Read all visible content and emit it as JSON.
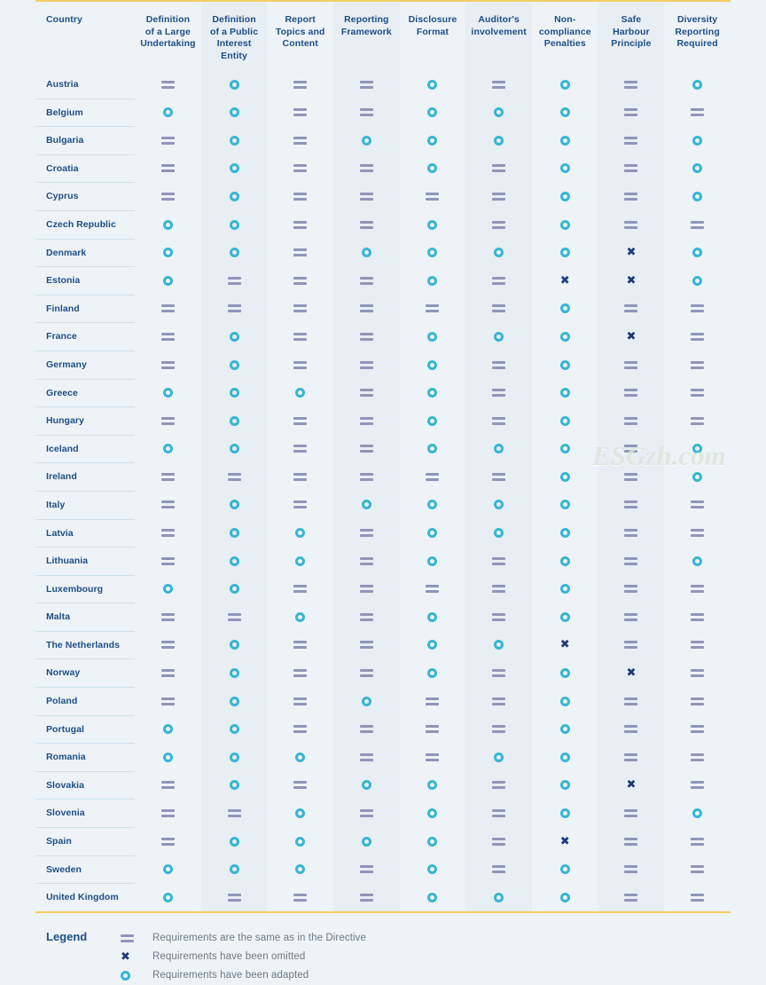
{
  "table": {
    "columns": [
      "Country",
      "Definition of a Large Undertaking",
      "Definition of a Public Interest Entity",
      "Report Topics and Content",
      "Reporting Framework",
      "Disclosure Format",
      "Auditor's involvement",
      "Non-compliance Penalties",
      "Safe Harbour Principle",
      "Diversity Reporting Required"
    ],
    "column_lines": [
      [
        "Country"
      ],
      [
        "Definition",
        "of a Large",
        "Undertaking"
      ],
      [
        "Definition",
        "of a Public",
        "Interest",
        "Entity"
      ],
      [
        "Report",
        "Topics and",
        "Content"
      ],
      [
        "Reporting",
        "Framework"
      ],
      [
        "Disclosure",
        "Format"
      ],
      [
        "Auditor's",
        "involvement"
      ],
      [
        "Non-",
        "compliance",
        "Penalties"
      ],
      [
        "Safe",
        "Harbour",
        "Principle"
      ],
      [
        "Diversity",
        "Reporting",
        "Required"
      ]
    ],
    "rows": [
      {
        "country": "Austria",
        "values": [
          "same",
          "adapted",
          "same",
          "same",
          "adapted",
          "same",
          "adapted",
          "same",
          "adapted"
        ]
      },
      {
        "country": "Belgium",
        "values": [
          "adapted",
          "adapted",
          "same",
          "same",
          "adapted",
          "adapted",
          "adapted",
          "same",
          "same"
        ]
      },
      {
        "country": "Bulgaria",
        "values": [
          "same",
          "adapted",
          "same",
          "adapted",
          "adapted",
          "adapted",
          "adapted",
          "same",
          "adapted"
        ]
      },
      {
        "country": "Croatia",
        "values": [
          "same",
          "adapted",
          "same",
          "same",
          "adapted",
          "same",
          "adapted",
          "same",
          "adapted"
        ]
      },
      {
        "country": "Cyprus",
        "values": [
          "same",
          "adapted",
          "same",
          "same",
          "same",
          "same",
          "adapted",
          "same",
          "adapted"
        ]
      },
      {
        "country": "Czech Republic",
        "values": [
          "adapted",
          "adapted",
          "same",
          "same",
          "adapted",
          "same",
          "adapted",
          "same",
          "same"
        ]
      },
      {
        "country": "Denmark",
        "values": [
          "adapted",
          "adapted",
          "same",
          "adapted",
          "adapted",
          "adapted",
          "adapted",
          "omitted",
          "adapted"
        ]
      },
      {
        "country": "Estonia",
        "values": [
          "adapted",
          "same",
          "same",
          "same",
          "adapted",
          "same",
          "omitted",
          "omitted",
          "adapted"
        ]
      },
      {
        "country": "Finland",
        "values": [
          "same",
          "same",
          "same",
          "same",
          "same",
          "same",
          "adapted",
          "same",
          "same"
        ]
      },
      {
        "country": "France",
        "values": [
          "same",
          "adapted",
          "same",
          "same",
          "adapted",
          "adapted",
          "adapted",
          "omitted",
          "same"
        ]
      },
      {
        "country": "Germany",
        "values": [
          "same",
          "adapted",
          "same",
          "same",
          "adapted",
          "same",
          "adapted",
          "same",
          "same"
        ]
      },
      {
        "country": "Greece",
        "values": [
          "adapted",
          "adapted",
          "adapted",
          "same",
          "adapted",
          "same",
          "adapted",
          "same",
          "same"
        ]
      },
      {
        "country": "Hungary",
        "values": [
          "same",
          "adapted",
          "same",
          "same",
          "adapted",
          "same",
          "adapted",
          "same",
          "same"
        ]
      },
      {
        "country": "Iceland",
        "values": [
          "adapted",
          "adapted",
          "same",
          "same",
          "adapted",
          "adapted",
          "adapted",
          "same",
          "adapted"
        ]
      },
      {
        "country": "Ireland",
        "values": [
          "same",
          "same",
          "same",
          "same",
          "same",
          "same",
          "adapted",
          "same",
          "adapted"
        ]
      },
      {
        "country": "Italy",
        "values": [
          "same",
          "adapted",
          "same",
          "adapted",
          "adapted",
          "adapted",
          "adapted",
          "same",
          "same"
        ]
      },
      {
        "country": "Latvia",
        "values": [
          "same",
          "adapted",
          "adapted",
          "same",
          "adapted",
          "adapted",
          "adapted",
          "same",
          "same"
        ]
      },
      {
        "country": "Lithuania",
        "values": [
          "same",
          "adapted",
          "adapted",
          "same",
          "adapted",
          "same",
          "adapted",
          "same",
          "adapted"
        ]
      },
      {
        "country": "Luxembourg",
        "values": [
          "adapted",
          "adapted",
          "same",
          "same",
          "same",
          "same",
          "adapted",
          "same",
          "same"
        ]
      },
      {
        "country": "Malta",
        "values": [
          "same",
          "same",
          "adapted",
          "same",
          "adapted",
          "same",
          "adapted",
          "same",
          "same"
        ]
      },
      {
        "country": "The Netherlands",
        "values": [
          "same",
          "adapted",
          "same",
          "same",
          "adapted",
          "adapted",
          "omitted",
          "same",
          "same"
        ]
      },
      {
        "country": "Norway",
        "values": [
          "same",
          "adapted",
          "same",
          "same",
          "adapted",
          "same",
          "adapted",
          "omitted",
          "same"
        ]
      },
      {
        "country": "Poland",
        "values": [
          "same",
          "adapted",
          "same",
          "adapted",
          "same",
          "same",
          "adapted",
          "same",
          "same"
        ]
      },
      {
        "country": "Portugal",
        "values": [
          "adapted",
          "adapted",
          "same",
          "same",
          "same",
          "same",
          "adapted",
          "same",
          "same"
        ]
      },
      {
        "country": "Romania",
        "values": [
          "adapted",
          "adapted",
          "adapted",
          "same",
          "same",
          "adapted",
          "adapted",
          "same",
          "same"
        ]
      },
      {
        "country": "Slovakia",
        "values": [
          "same",
          "adapted",
          "same",
          "adapted",
          "adapted",
          "same",
          "adapted",
          "omitted",
          "same"
        ]
      },
      {
        "country": "Slovenia",
        "values": [
          "same",
          "same",
          "adapted",
          "same",
          "adapted",
          "same",
          "adapted",
          "same",
          "adapted"
        ]
      },
      {
        "country": "Spain",
        "values": [
          "same",
          "adapted",
          "adapted",
          "adapted",
          "adapted",
          "same",
          "omitted",
          "same",
          "same"
        ]
      },
      {
        "country": "Sweden",
        "values": [
          "adapted",
          "adapted",
          "adapted",
          "same",
          "adapted",
          "same",
          "adapted",
          "same",
          "same"
        ]
      },
      {
        "country": "United Kingdom",
        "values": [
          "adapted",
          "same",
          "same",
          "same",
          "adapted",
          "adapted",
          "adapted",
          "same",
          "same"
        ]
      }
    ]
  },
  "legend": {
    "title": "Legend",
    "items": [
      {
        "symbol": "same",
        "text": "Requirements are the same as in the Directive"
      },
      {
        "symbol": "omitted",
        "text": "Requirements have been omitted"
      },
      {
        "symbol": "adapted",
        "text": "Requirements have been adapted"
      }
    ]
  },
  "watermark": {
    "text": "ESGzh.com"
  },
  "colors": {
    "rule": "#f2cf63",
    "header_text": "#1f4e86",
    "adapted": "#37b6d3",
    "omitted": "#1e3a7b",
    "same": "#8e96b8",
    "page_bg": "#eef3f7",
    "row_divider": "#cfe2ee",
    "legend_text": "#6b7a86"
  }
}
